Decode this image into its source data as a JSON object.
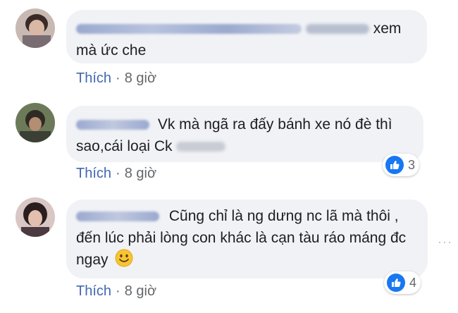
{
  "comments": [
    {
      "text_line1": "xem",
      "text_line2": "mà ức che",
      "like_label": "Thích",
      "separator": "·",
      "time": "8 giờ"
    },
    {
      "text_line1": "Vk mà ngã ra đấy bánh xe nó đè thì",
      "text_line2": "sao,cái loại Ck",
      "like_label": "Thích",
      "separator": "·",
      "time": "8 giờ",
      "reaction_count": "3"
    },
    {
      "text_line1": "Cũng chỉ là ng dưng nc lã mà thôi ,",
      "text_line2": "đến lúc phải lòng con khác là cạn tàu ráo máng đc",
      "text_line3": "ngay",
      "like_label": "Thích",
      "separator": "·",
      "time": "8 giờ",
      "reaction_count": "4",
      "more_options": "···"
    }
  ],
  "colors": {
    "bubble": "#f0f2f5",
    "like_link": "#4267b2",
    "meta_text": "#65676b",
    "reaction_blue": "#1877f2"
  },
  "icons": [
    "thumbs-up-icon",
    "smiley-emoji-icon",
    "more-options-icon"
  ]
}
